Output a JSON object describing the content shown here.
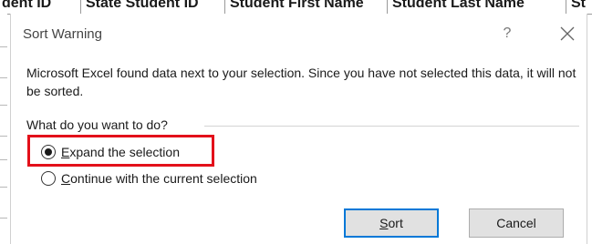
{
  "spreadsheet": {
    "columns": [
      "dent ID",
      "State Student ID",
      "Student First Name",
      "Student Last Name",
      "St"
    ]
  },
  "dialog": {
    "title": "Sort Warning",
    "help_label": "?",
    "message": "Microsoft Excel found data next to your selection.  Since you have not selected this data, it will not be sorted.",
    "question": "What do you want to do?",
    "options": [
      {
        "access_key": "E",
        "rest": "xpand the selection",
        "checked": true
      },
      {
        "access_key": "C",
        "rest": "ontinue with the current selection",
        "checked": false
      }
    ],
    "sort_button": {
      "access_key": "S",
      "rest": "ort"
    },
    "cancel_button": "Cancel"
  },
  "colors": {
    "highlight": "#e3101a",
    "default_button_border": "#0078d7",
    "button_face": "#e1e1e1"
  },
  "icons": {
    "close": "close-icon"
  }
}
